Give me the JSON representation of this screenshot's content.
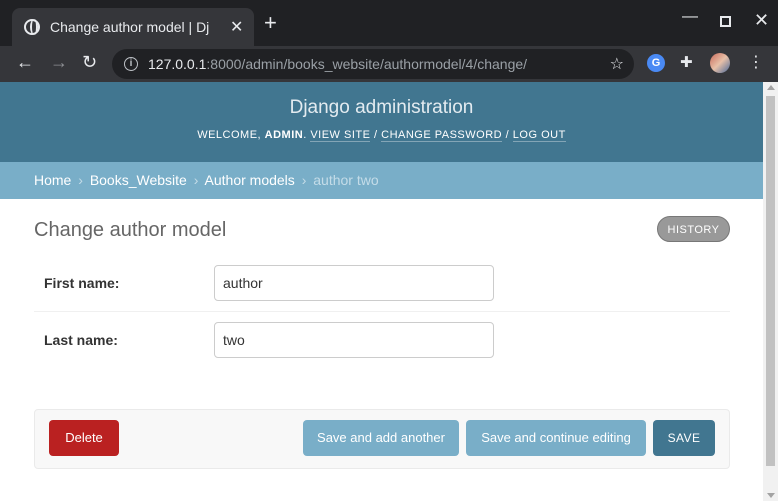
{
  "browser": {
    "tab_title": "Change author model | Dj",
    "tab_close": "✕",
    "new_tab": "+",
    "window": {
      "minimize": "—",
      "close": "✕"
    },
    "nav": {
      "back": "←",
      "forward": "→",
      "reload": "↻"
    },
    "url_host": "127.0.0.1",
    "url_rest": ":8000/admin/books_website/authormodel/4/change/",
    "star": "☆",
    "ext_g": "G",
    "ext_puzzle": "✚",
    "menu": "⋮"
  },
  "header": {
    "branding": "Django administration",
    "welcome": "Welcome, ",
    "user": "admin",
    "dot": ". ",
    "view_site": "View site",
    "sep1": " / ",
    "change_password": "Change password",
    "sep2": " / ",
    "log_out": "Log out"
  },
  "breadcrumbs": {
    "home": "Home",
    "app": "Books_Website",
    "model": "Author models",
    "current": "author two",
    "sep": "›"
  },
  "page": {
    "title": "Change author model",
    "history": "HISTORY"
  },
  "form": {
    "first_name": {
      "label": "First name:",
      "value": "author"
    },
    "last_name": {
      "label": "Last name:",
      "value": "two"
    }
  },
  "submit": {
    "delete": "Delete",
    "save_add": "Save and add another",
    "save_continue": "Save and continue editing",
    "save": "SAVE"
  },
  "colors": {
    "header_bg": "#417690",
    "breadcrumb_bg": "#79aec8",
    "delete_bg": "#ba2121",
    "save_bg": "#417690"
  }
}
